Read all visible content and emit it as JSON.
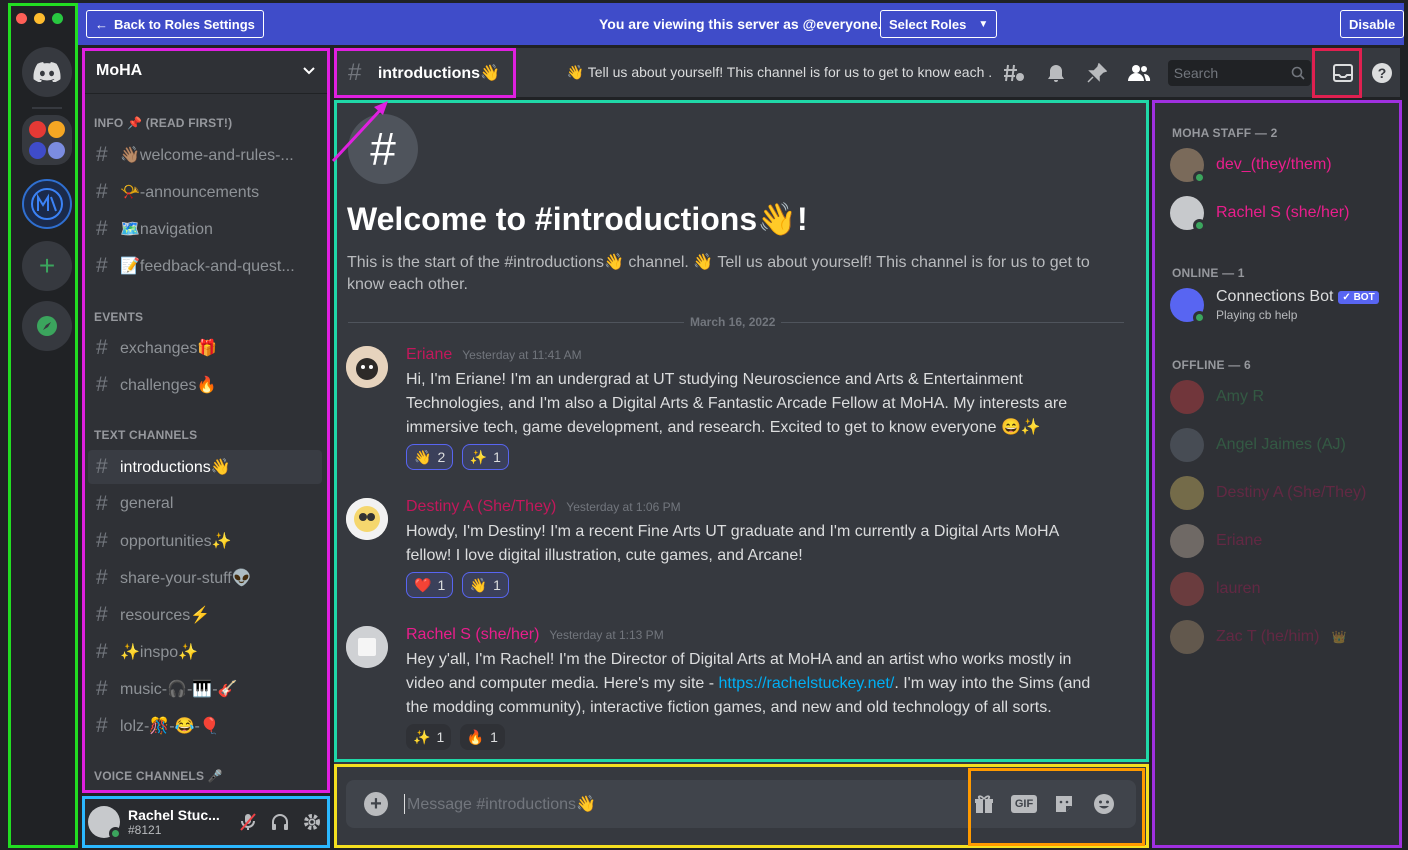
{
  "topbar": {
    "back_label": "Back to Roles Settings",
    "viewing_text": "You are viewing this server as @everyone.",
    "select_roles": "Select Roles",
    "disable": "Disable"
  },
  "server": {
    "name": "MoHA"
  },
  "categories": [
    {
      "name": "INFO 📌 (READ FIRST!)",
      "channels": [
        {
          "label": "👋🏽welcome-and-rules-..."
        },
        {
          "label": "📯-announcements"
        },
        {
          "label": "🗺️navigation"
        },
        {
          "label": "📝feedback-and-quest..."
        }
      ]
    },
    {
      "name": "EVENTS",
      "channels": [
        {
          "label": "exchanges🎁"
        },
        {
          "label": "challenges🔥"
        }
      ]
    },
    {
      "name": "TEXT CHANNELS",
      "channels": [
        {
          "label": "introductions👋"
        },
        {
          "label": "general"
        },
        {
          "label": "opportunities✨"
        },
        {
          "label": "share-your-stuff👽"
        },
        {
          "label": "resources⚡"
        },
        {
          "label": "✨inspo✨"
        },
        {
          "label": "music-🎧-🎹-🎸"
        },
        {
          "label": "lolz-🎊-😂-🎈"
        }
      ]
    },
    {
      "name": "VOICE CHANNELS 🎤",
      "channels": []
    }
  ],
  "user": {
    "name": "Rachel Stuc...",
    "tag": "#8121"
  },
  "channel_header": {
    "name": "introductions👋",
    "topic": "👋 Tell us about yourself! This channel is for us to get to know each ...",
    "search_placeholder": "Search"
  },
  "welcome": {
    "title": "Welcome to #introductions👋!",
    "desc": "This is the start of the #introductions👋 channel. 👋 Tell us about yourself! This channel is for us to get to know each other.",
    "date_divider": "March 16, 2022"
  },
  "messages": [
    {
      "author": "Eriane",
      "author_color": "#c2185b",
      "time": "Yesterday at 11:41 AM",
      "text": "Hi, I'm Eriane! I'm an undergrad at UT studying Neuroscience and Arts & Entertainment Technologies, and I'm also a Digital Arts & Fantastic Arcade Fellow at MoHA. My interests are immersive tech, game development, and research. Excited to get to know everyone 😄✨",
      "reactions": [
        {
          "emoji": "👋",
          "count": "2"
        },
        {
          "emoji": "✨",
          "count": "1"
        }
      ]
    },
    {
      "author": "Destiny A (She/They)",
      "author_color": "#c2185b",
      "time": "Yesterday at 1:06 PM",
      "text": "Howdy, I'm Destiny! I'm a recent Fine Arts UT graduate and I'm currently a Digital Arts MoHA fellow! I love digital illustration, cute games, and Arcane!",
      "reactions": [
        {
          "emoji": "❤️",
          "count": "1"
        },
        {
          "emoji": "👋",
          "count": "1"
        }
      ]
    },
    {
      "author": "Rachel S (she/her)",
      "author_color": "#e91e8c",
      "time": "Yesterday at 1:13 PM",
      "text_before": "Hey y'all, I'm Rachel! I'm the Director of Digital Arts at MoHA and an artist who works mostly in video and computer media. Here's my site - ",
      "link": "https://rachelstuckey.net/",
      "text_after": ". I'm way into the Sims (and the modding community), interactive fiction games, and new and old technology of all sorts.",
      "reactions": [
        {
          "emoji": "✨",
          "count": "1"
        },
        {
          "emoji": "🔥",
          "count": "1"
        }
      ]
    }
  ],
  "composer": {
    "placeholder": "Message #introductions👋",
    "gif": "GIF"
  },
  "members": {
    "staff_header": "MOHA STAFF — 2",
    "staff": [
      {
        "name": "dev_(they/them)"
      },
      {
        "name": "Rachel S (she/her)"
      }
    ],
    "online_header": "ONLINE — 1",
    "online": [
      {
        "name": "Connections Bot",
        "bot_tag": "✓ BOT",
        "activity": "Playing cb help"
      }
    ],
    "offline_header": "OFFLINE — 6",
    "offline": [
      {
        "name": "Amy R"
      },
      {
        "name": "Angel Jaimes (AJ)"
      },
      {
        "name": "Destiny A (She/They)"
      },
      {
        "name": "Eriane"
      },
      {
        "name": "lauren"
      },
      {
        "name": "Zac T (he/him)",
        "badge": "👑"
      }
    ]
  },
  "colors": {
    "accent": "#5865f2",
    "topbar": "#3f4cc9",
    "online": "#3ba55d",
    "staff_role": "#e91e8c",
    "link": "#00aff4"
  }
}
